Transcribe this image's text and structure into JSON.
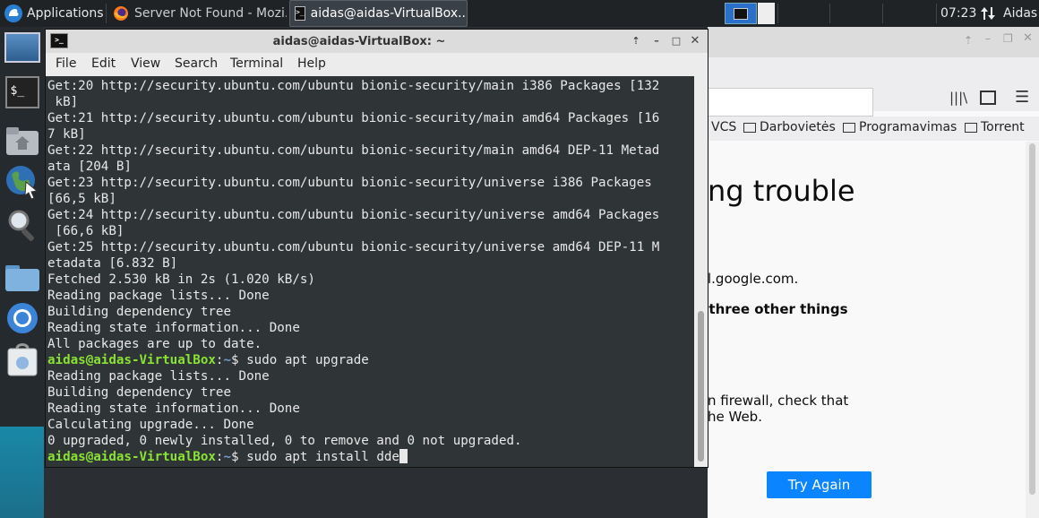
{
  "panel": {
    "applications_label": "Applications",
    "tasks": [
      {
        "label": "Server Not Found - Mozi..."
      },
      {
        "label": "aidas@aidas-VirtualBox..."
      }
    ],
    "clock": "07:23",
    "user": "Aidas"
  },
  "terminal": {
    "title": "aidas@aidas-VirtualBox: ~",
    "menu": [
      "File",
      "Edit",
      "View",
      "Search",
      "Terminal",
      "Help"
    ],
    "output": [
      "Get:20 http://security.ubuntu.com/ubuntu bionic-security/main i386 Packages [132",
      " kB]",
      "Get:21 http://security.ubuntu.com/ubuntu bionic-security/main amd64 Packages [16",
      "7 kB]",
      "Get:22 http://security.ubuntu.com/ubuntu bionic-security/main amd64 DEP-11 Metad",
      "ata [204 B]",
      "Get:23 http://security.ubuntu.com/ubuntu bionic-security/universe i386 Packages",
      "[66,5 kB]",
      "Get:24 http://security.ubuntu.com/ubuntu bionic-security/universe amd64 Packages",
      " [66,6 kB]",
      "Get:25 http://security.ubuntu.com/ubuntu bionic-security/universe amd64 DEP-11 M",
      "etadata [6.832 B]",
      "Fetched 2.530 kB in 2s (1.020 kB/s)",
      "Reading package lists... Done",
      "Building dependency tree",
      "Reading state information... Done",
      "All packages are up to date."
    ],
    "prompt_user": "aidas@aidas-VirtualBox",
    "prompt_path": "~",
    "command1": "sudo apt upgrade",
    "output2": [
      "Reading package lists... Done",
      "Building dependency tree",
      "Reading state information... Done",
      "Calculating upgrade... Done",
      "0 upgraded, 0 newly installed, 0 to remove and 0 not upgraded."
    ],
    "command2_input": "sudo apt install dde"
  },
  "firefox": {
    "bookmarks": [
      "VCS",
      "Darbovietės",
      "Programavimas",
      "Torrent"
    ],
    "error_heading_partial": "ng trouble",
    "text_fragment_1": "l.google.com.",
    "text_fragment_2": "e three other things",
    "text_fragment_3": "n firewall, check that",
    "text_fragment_4": "he Web.",
    "try_again_label": "Try Again",
    "accent_color": "#0a84ff"
  }
}
